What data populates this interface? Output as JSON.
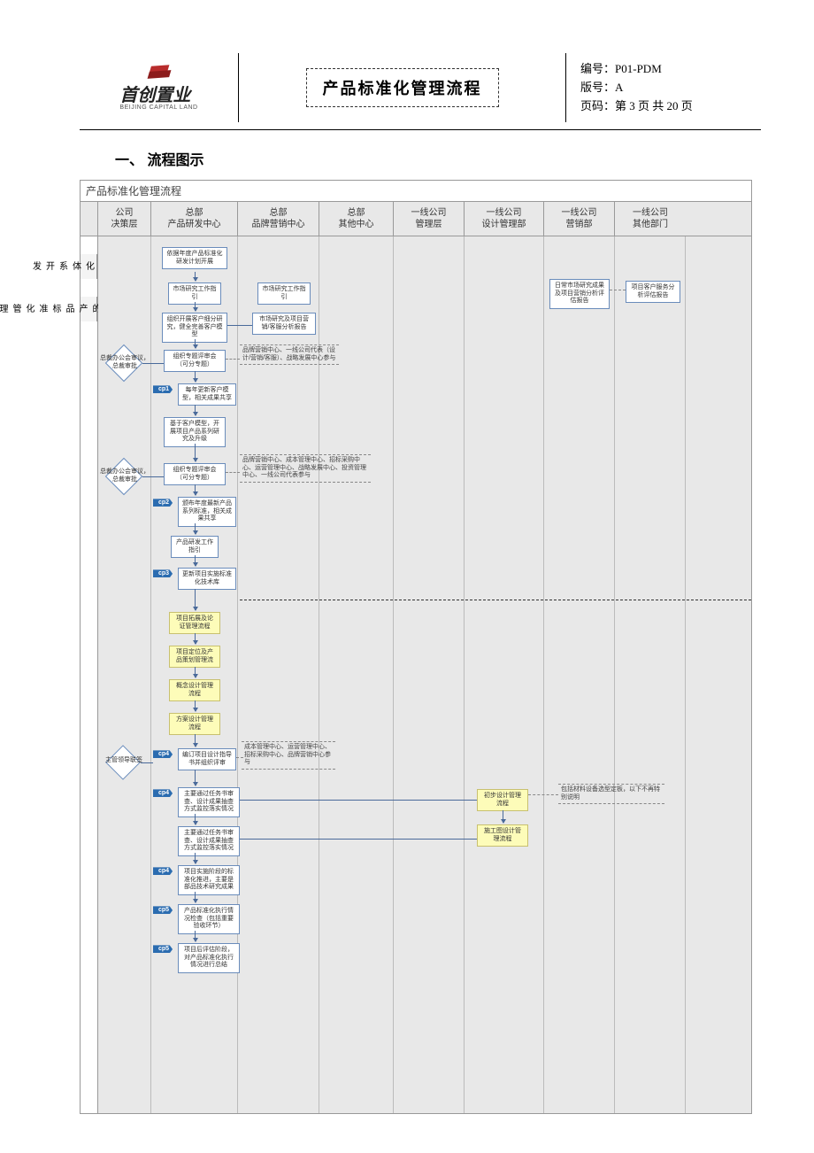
{
  "header": {
    "logo_cn": "首创置业",
    "logo_en": "BEIJING CAPITAL LAND",
    "doc_title": "产品标准化管理流程",
    "code_label": "编号：",
    "code_value": "P01-PDM",
    "version_label": "版号：",
    "version_value": "A",
    "page_label": "页码：",
    "page_value": "第 3 页 共 20 页"
  },
  "section": {
    "h1": "一、 流程图示"
  },
  "flow": {
    "title": "产品标准化管理流程",
    "lanes": [
      "公司\n决策层",
      "总部\n产品研发中心",
      "总部\n品牌营销中心",
      "总部\n其他中心",
      "一线公司\n管理层",
      "一线公司\n设计管理部",
      "一线公司\n营销部",
      "一线公司\n其他部门"
    ],
    "side_labels": [
      "产品标准化体系开发",
      "项目实施阶段的产品标准化管理"
    ]
  },
  "nodes": {
    "n1": "依据年度产品标准化研发计划开展",
    "n2": "市场研究工作指引",
    "n3": "市场研究工作指引",
    "n4": "组织开展客户细分研究，健全完善客户模型",
    "n5": "市场研究及项目营销/客服分析报告",
    "n6": "组织专题评审会（可分专题）",
    "n7": "品牌营销中心、一线公司代表（设计/营销/客服）、战略发展中心参与",
    "d1": "总裁办公会审议，总裁审批",
    "cp1": "cp1",
    "n8": "每年更新客户模型，相关成果共享",
    "n9": "基于客户模型，开展项目产品系列研究及升级",
    "n10": "组织专题评审会（可分专题）",
    "n11": "品牌营销中心、成本管理中心、招标采购中心、运营管理中心、战略发展中心、投资管理中心、一线公司代表参与",
    "d2": "总裁办公会审议，总裁审批",
    "cp2": "cp2",
    "n12": "颁布年度最新产品系列标准，相关成果共享",
    "n13": "产品研发工作指引",
    "cp3": "cp3",
    "n14": "更新项目实施标准化技术库",
    "y1": "项目拓展及论证管理流程",
    "y2": "项目定位及产品策划管理流",
    "y3": "概念设计管理流程",
    "y4": "方案设计管理流程",
    "cp4a": "cp4",
    "n15": "编订项目设计指导书并组织评审",
    "n16": "成本管理中心、运营管理中心、招标采购中心、品牌营销中心参与",
    "d3": "主管领导联签",
    "cp4b": "cp4",
    "n17": "主要通过任务书审查、设计成果抽查方式监控落实情况",
    "n18": "主要通过任务书审查、设计成果抽查方式监控落实情况",
    "cp4c": "cp4",
    "n19": "项目实施阶段的标准化推进，主要是部品技术研究成果",
    "cp5a": "cp5",
    "n20": "产品标准化执行情况检查（包括重要验收环节）",
    "cp5b": "cp5",
    "n21": "项目后评估阶段，对产品标准化执行情况进行总结",
    "yd1": "初步设计管理流程",
    "yd2": "施工图设计管理流程",
    "right1": "日常市场研究成果及项目营销分析评估报告",
    "right2": "项目客户服务分析评估报告",
    "right3": "包括材料设备选型定板，以下不再特别说明"
  }
}
